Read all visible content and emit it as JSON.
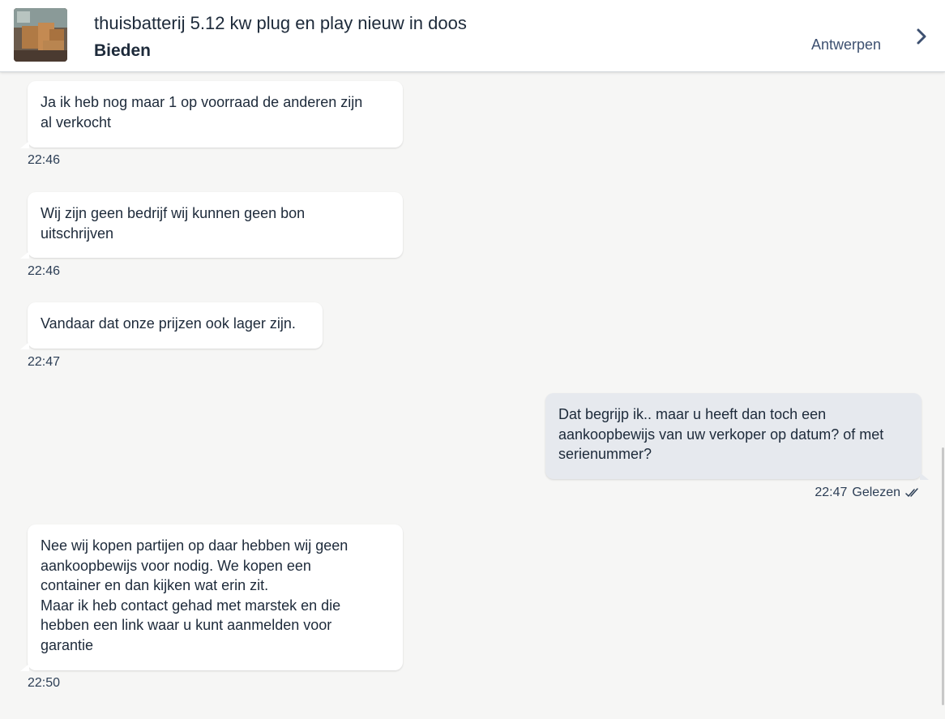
{
  "header": {
    "title": "thuisbatterij 5.12 kw plug en play nieuw in doos",
    "bid_label": "Bieden",
    "location": "Antwerpen",
    "thumbnail_icon": "product-photo",
    "chevron_icon": "chevron-right-icon"
  },
  "messages": [
    {
      "side": "left",
      "text": "Ja ik heb nog maar 1 op voorraad de anderen zijn\nal verkocht",
      "time": "22:46"
    },
    {
      "side": "left",
      "text": "Wij zijn geen bedrijf wij kunnen geen bon\nuitschrijven",
      "time": "22:46"
    },
    {
      "side": "left",
      "text": "Vandaar dat onze prijzen ook lager zijn.",
      "time": "22:47"
    },
    {
      "side": "right",
      "text": "Dat begrijp ik.. maar u heeft dan toch een\naankoopbewijs van uw verkoper op datum? of met\nserienummer?",
      "time": "22:47",
      "status": "Gelezen"
    },
    {
      "side": "left",
      "text": "Nee wij kopen partijen op daar hebben wij geen\naankoopbewijs voor nodig. We kopen een\ncontainer en dan kijken wat erin zit.\nMaar ik heb contact gehad met marstek en die\nhebben een link waar u kunt aanmelden voor\ngarantie",
      "time": "22:50"
    }
  ],
  "colors": {
    "background": "#f6f6f5",
    "own_bubble": "#e6e9ee",
    "other_bubble": "#ffffff",
    "text": "#1d2a3a"
  }
}
